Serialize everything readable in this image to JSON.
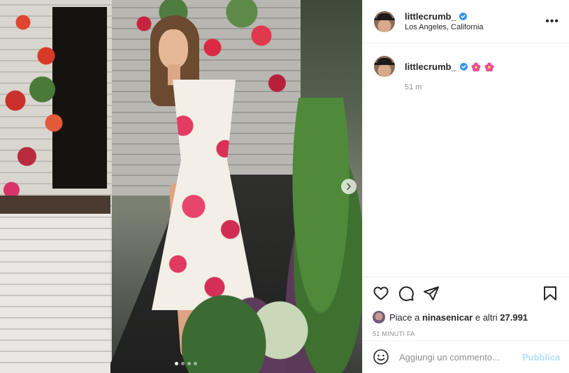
{
  "post": {
    "username": "littlecrumb_",
    "location": "Los Angeles, California",
    "verified": true
  },
  "caption": {
    "username": "littlecrumb_",
    "emojis": [
      "hibiscus-flower",
      "hibiscus-flower"
    ],
    "time": "51 m"
  },
  "likes": {
    "prefix": "Piace a ",
    "user": "ninasenicar",
    "middle": " e altri ",
    "count": "27.991"
  },
  "timestamp": "51 MINUTI FA",
  "comment_box": {
    "placeholder": "Aggiungi un commento...",
    "publish_label": "Pubblica"
  },
  "carousel": {
    "total_slides": 4,
    "current_slide": 1
  },
  "colors": {
    "text": "#262626",
    "secondary_text": "#8e8e8e",
    "verified_blue": "#3897f0",
    "publish_disabled": "#b2dffc",
    "border": "#efefef"
  },
  "icons": {
    "more": "more-options-icon",
    "like": "heart-icon",
    "comment": "comment-bubble-icon",
    "share": "paper-plane-icon",
    "save": "bookmark-icon",
    "emoji": "smiley-icon",
    "next": "chevron-right-icon"
  }
}
